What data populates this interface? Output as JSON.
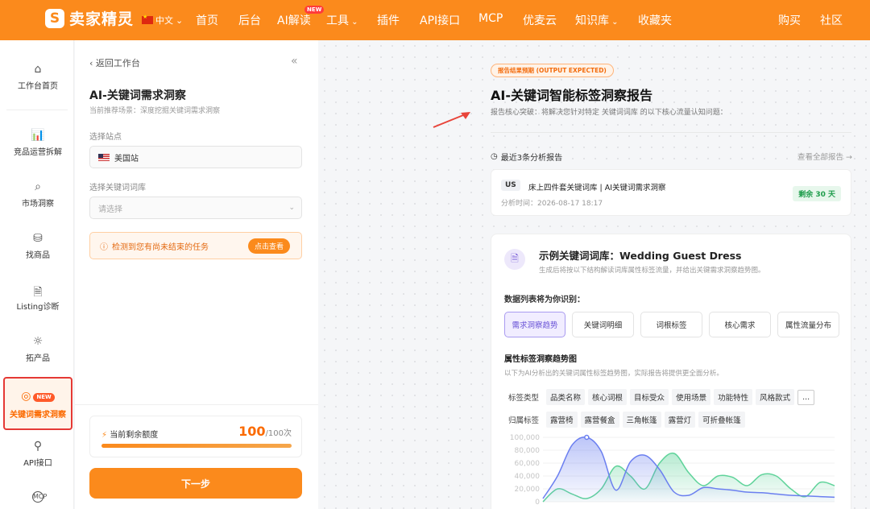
{
  "brand": {
    "name": "卖家精灵",
    "mark": "S"
  },
  "topbar": {
    "language": "中文",
    "nav": [
      "首页",
      "后台",
      "AI解读",
      "工具",
      "插件",
      "API接口",
      "MCP",
      "优麦云",
      "知识库",
      "收藏夹",
      "购买",
      "社区"
    ],
    "new_badge": "NEW"
  },
  "sidebar": {
    "items": [
      {
        "label": "工作台首页",
        "icon": "home-icon"
      },
      {
        "label": "竞品运营拆解",
        "icon": "bar-chart-icon"
      },
      {
        "label": "市场洞察",
        "icon": "search-icon"
      },
      {
        "label": "找商品",
        "icon": "boxes-icon"
      },
      {
        "label": "Listing诊断",
        "icon": "file-check-icon"
      },
      {
        "label": "拓产品",
        "icon": "bulb-icon"
      },
      {
        "label": "关键词需求洞察",
        "icon": "target-icon",
        "badge": "NEW",
        "active": true
      },
      {
        "label": "API接口",
        "icon": "plug-icon"
      },
      {
        "label": "MCP",
        "icon": "mcp-icon"
      }
    ]
  },
  "panel": {
    "back": "返回工作台",
    "title": "AI-关键词需求洞察",
    "subtitle": "当前推荐场景：深度挖掘关键词需求洞察",
    "site_label": "选择站点",
    "site_value": "美国站",
    "library_label": "选择关键词词库",
    "library_placeholder": "请选择",
    "warning": "检测到您有尚未结束的任务",
    "warning_button": "点击查看",
    "quota_label": "当前剩余额度",
    "quota_value": "100",
    "quota_total": "/100次",
    "quota_fraction": 1.0,
    "next_button": "下一步"
  },
  "report": {
    "badge": "报告结果预期 (OUTPUT EXPECTED)",
    "title": "AI-关键词智能标签洞察报告",
    "subtitle": "报告核心突破：将解决您针对特定 关键词词库 的以下核心流量认知问题：",
    "recent_heading": "最近3条分析报告",
    "view_all": "查看全部报告 →",
    "recent": {
      "code": "US",
      "name": "床上四件套关键词库 | AI关键词需求洞察",
      "time": "分析时间：2026-08-17 18:17",
      "days": "剩余 30 天"
    }
  },
  "sample": {
    "title": "示例关键词词库：Wedding Guest Dress",
    "subtitle": "生成后将按以下结构解读词库属性标签流量，并给出关键需求洞察趋势图。",
    "list_heading": "数据列表将为你识别：",
    "tabs": [
      "需求洞察趋势",
      "关键词明细",
      "词根标签",
      "核心需求",
      "属性流量分布"
    ],
    "active_tab": 0,
    "chart_heading": "属性标签洞察趋势图",
    "chart_subtitle": "以下为AI分析出的关键词属性标签趋势图，实际报告将提供更全面分析。",
    "tag_type_label": "标签类型",
    "tag_types": [
      "品类名称",
      "核心词根",
      "目标受众",
      "使用场景",
      "功能特性",
      "风格款式",
      "..."
    ],
    "belong_label": "归属标签",
    "belong_tags": [
      "露营椅",
      "露营餐盒",
      "三角帐篷",
      "露营灯",
      "可折叠帐篷"
    ]
  },
  "chart_data": {
    "type": "area",
    "x": [
      0,
      1,
      2,
      3,
      4,
      5,
      6,
      7,
      8,
      9,
      10,
      11,
      12,
      13,
      14,
      15,
      16,
      17,
      18,
      19,
      20
    ],
    "ylim": [
      0,
      100000
    ],
    "yticks": [
      "100,000",
      "80,000",
      "60,000",
      "40,000",
      "20,000",
      "0"
    ],
    "series": [
      {
        "values": [
          5000,
          40000,
          88000,
          100000,
          78000,
          18000,
          62000,
          72000,
          50000,
          15000,
          10000,
          22000,
          20000,
          18000,
          15000,
          14000,
          12000,
          10000,
          9000,
          8000,
          7000
        ],
        "color": "#6b7ff0"
      },
      {
        "values": [
          0,
          20000,
          12000,
          5000,
          20000,
          55000,
          40000,
          20000,
          60000,
          75000,
          45000,
          25000,
          40000,
          38000,
          25000,
          42000,
          40000,
          20000,
          8000,
          30000,
          25000
        ],
        "color": "#5fd39a"
      }
    ]
  }
}
